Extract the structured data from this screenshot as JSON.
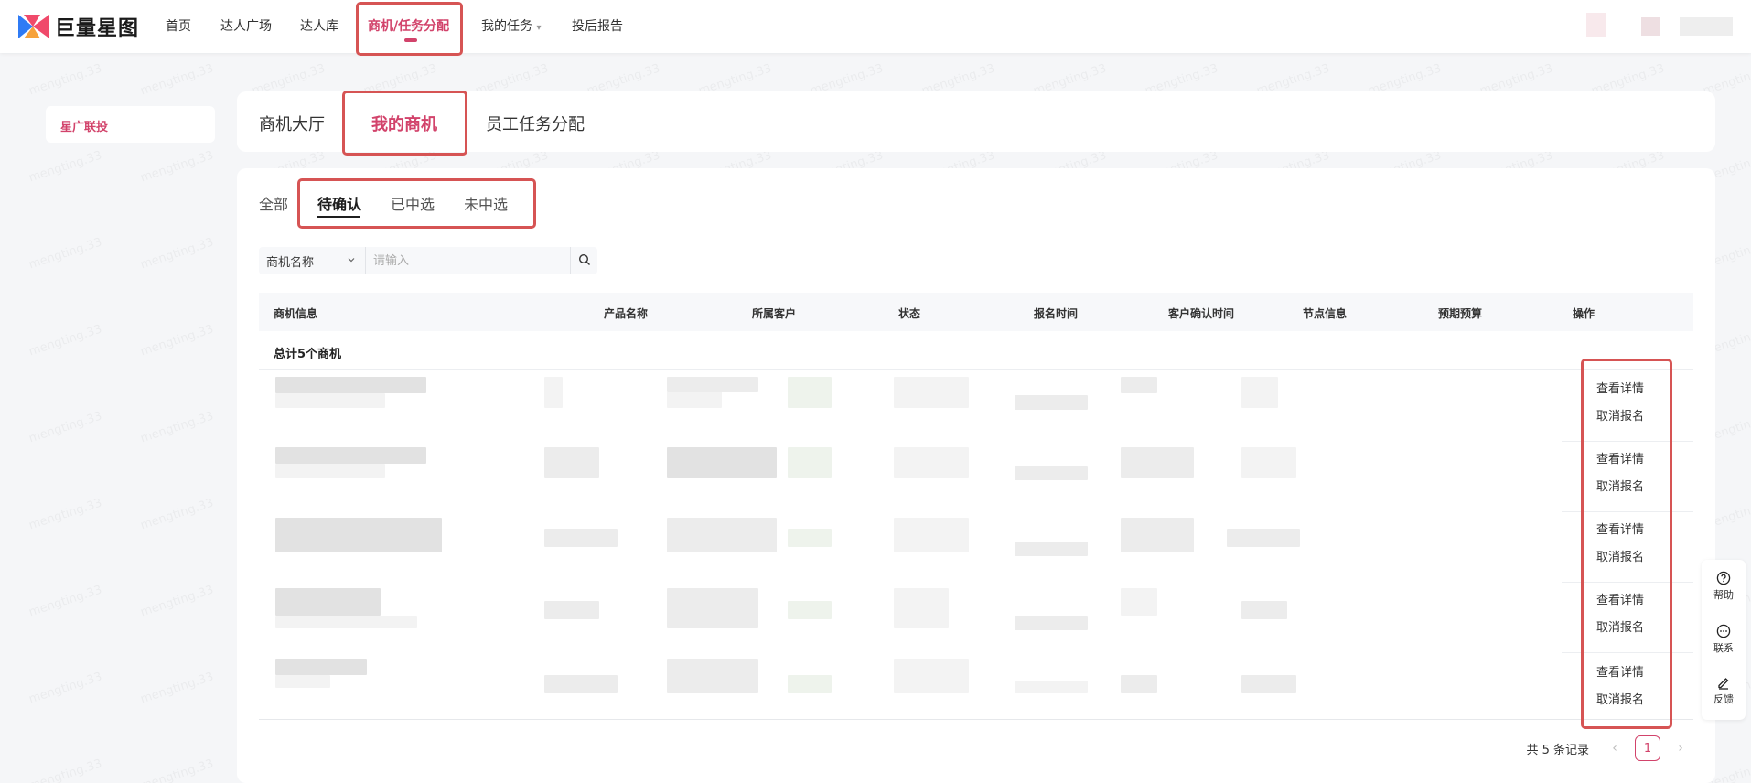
{
  "brand": {
    "name": "巨量星图"
  },
  "nav": {
    "items": [
      {
        "label": "首页"
      },
      {
        "label": "达人广场"
      },
      {
        "label": "达人库"
      },
      {
        "label": "商机/任务分配"
      },
      {
        "label": "我的任务",
        "dropdown": "▾"
      },
      {
        "label": "投后报告"
      }
    ],
    "active": "商机/任务分配"
  },
  "sidebar": {
    "items": [
      {
        "label": "星广联投"
      }
    ]
  },
  "main_tabs": [
    {
      "label": "商机大厅"
    },
    {
      "label": "我的商机"
    },
    {
      "label": "员工任务分配"
    }
  ],
  "sub_tabs": [
    {
      "label": "全部"
    },
    {
      "label": "待确认"
    },
    {
      "label": "已中选"
    },
    {
      "label": "未中选"
    }
  ],
  "search": {
    "field": "商机名称",
    "placeholder": "请输入"
  },
  "table": {
    "columns": [
      "商机信息",
      "产品名称",
      "所属客户",
      "状态",
      "报名时间",
      "客户确认时间",
      "节点信息",
      "预期预算",
      "操作"
    ],
    "total": "总计5个商机",
    "rows": [
      {
        "actions": [
          "查看详情",
          "取消报名"
        ]
      },
      {
        "actions": [
          "查看详情",
          "取消报名"
        ]
      },
      {
        "actions": [
          "查看详情",
          "取消报名"
        ]
      },
      {
        "actions": [
          "查看详情",
          "取消报名"
        ]
      },
      {
        "actions": [
          "查看详情",
          "取消报名"
        ]
      }
    ]
  },
  "pagination": {
    "summary": "共 5 条记录",
    "current": "1"
  },
  "tools": [
    {
      "label": "帮助",
      "icon": "help-icon"
    },
    {
      "label": "联系",
      "icon": "chat-icon"
    },
    {
      "label": "反馈",
      "icon": "edit-icon"
    }
  ],
  "watermark_text": "mengting.33",
  "colors": {
    "accent": "#d2436b",
    "highlight": "#d65454"
  }
}
